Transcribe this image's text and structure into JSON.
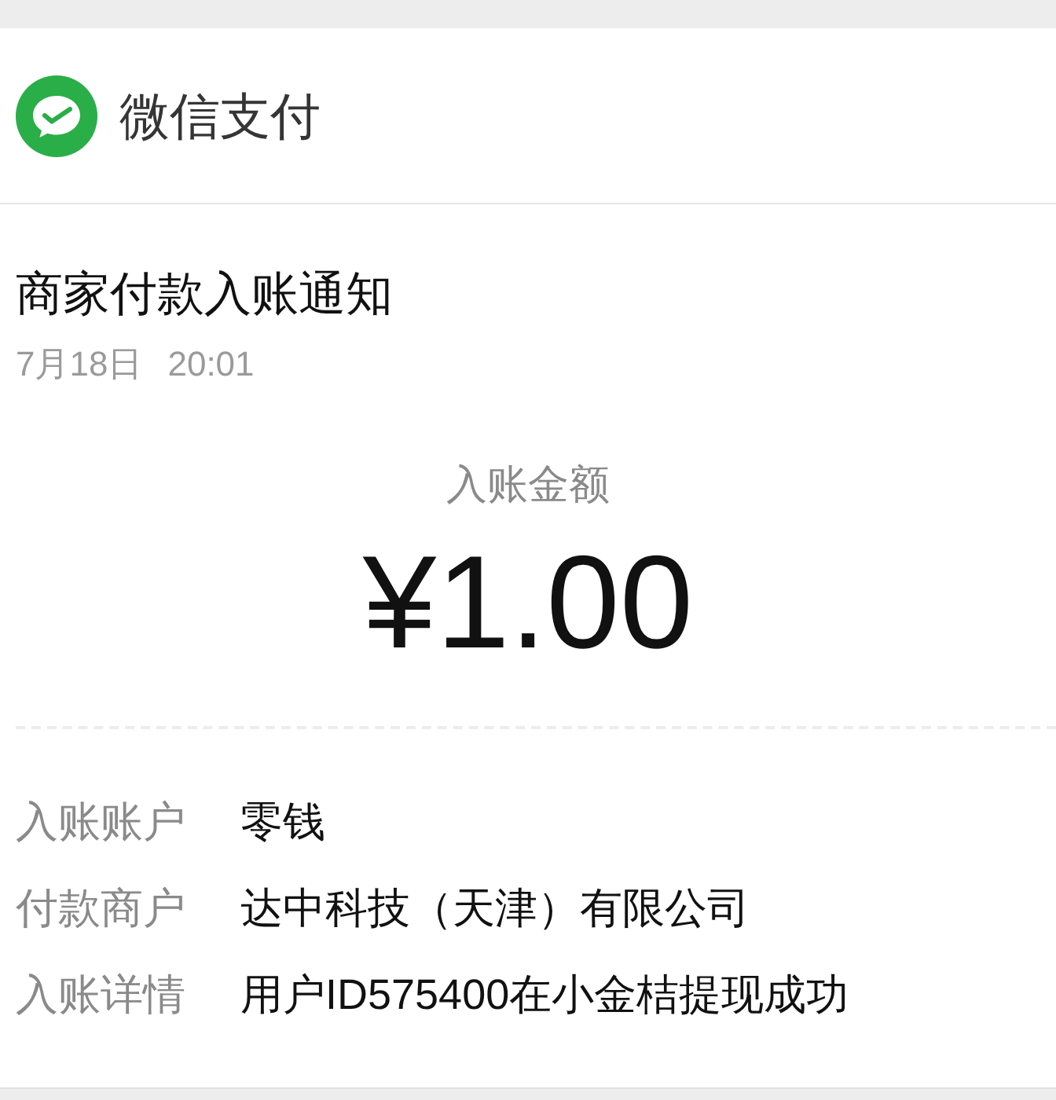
{
  "header": {
    "app_name": "微信支付"
  },
  "notice": {
    "title": "商家付款入账通知",
    "date": "7月18日",
    "time": "20:01"
  },
  "amount": {
    "label": "入账金额",
    "value": "¥1.00"
  },
  "details": [
    {
      "label": "入账账户",
      "value": "零钱"
    },
    {
      "label": "付款商户",
      "value": "达中科技（天津）有限公司"
    },
    {
      "label": "入账详情",
      "value": "用户ID575400在小金桔提现成功"
    }
  ]
}
